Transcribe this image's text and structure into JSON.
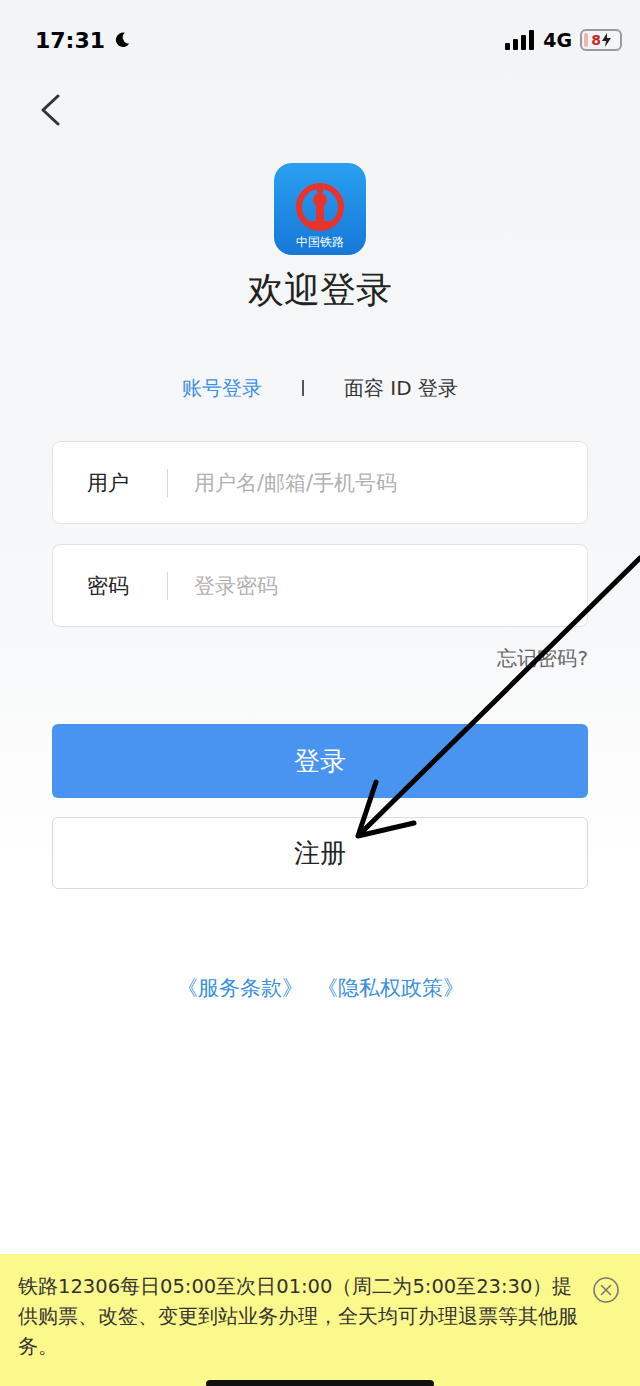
{
  "status_bar": {
    "time": "17:31",
    "network": "4G",
    "battery": "8"
  },
  "logo": {
    "caption": "中国铁路"
  },
  "title": "欢迎登录",
  "tabs": [
    {
      "label": "账号登录",
      "selected": true
    },
    {
      "label": "面容 ID 登录",
      "selected": false
    }
  ],
  "fields": [
    {
      "label": "用户",
      "placeholder": "用户名/邮箱/手机号码"
    },
    {
      "label": "密码",
      "placeholder": "登录密码"
    }
  ],
  "forgot": "忘记密码?",
  "buttons": [
    {
      "label": "登录",
      "kind": "primary"
    },
    {
      "label": "注册",
      "kind": "secondary"
    }
  ],
  "links": [
    "《服务条款》",
    "《隐私权政策》"
  ],
  "notice": {
    "text": "铁路12306每日05:00至次日01:00（周二为5:00至23:30）提供购票、改签、变更到站业务办理，全天均可办理退票等其他服务。"
  }
}
